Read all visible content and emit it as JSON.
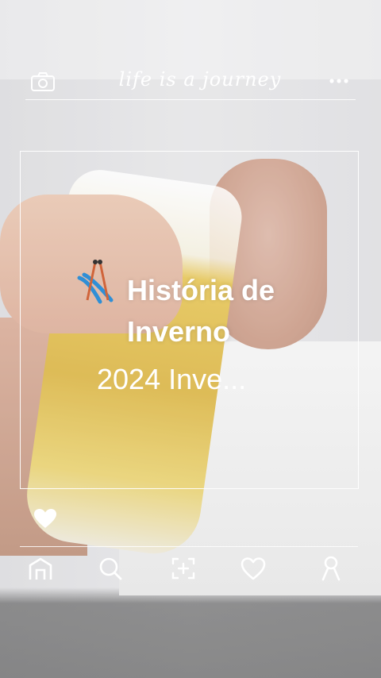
{
  "header": {
    "title": "life is a journey",
    "left_icon": "camera-icon",
    "right_icon": "more-icon"
  },
  "story": {
    "icon": "skis-icon",
    "title_line1": "História de",
    "title_line2": "Inverno",
    "subtitle": "2024 Inve..."
  },
  "like_icon": "heart-filled-icon",
  "nav": {
    "items": [
      {
        "name": "home",
        "icon": "home-icon"
      },
      {
        "name": "search",
        "icon": "search-icon"
      },
      {
        "name": "add",
        "icon": "add-photo-icon"
      },
      {
        "name": "likes",
        "icon": "heart-icon"
      },
      {
        "name": "profile",
        "icon": "profile-icon"
      }
    ]
  },
  "colors": {
    "overlay_line": "#ffffff",
    "text": "#ffffff"
  }
}
